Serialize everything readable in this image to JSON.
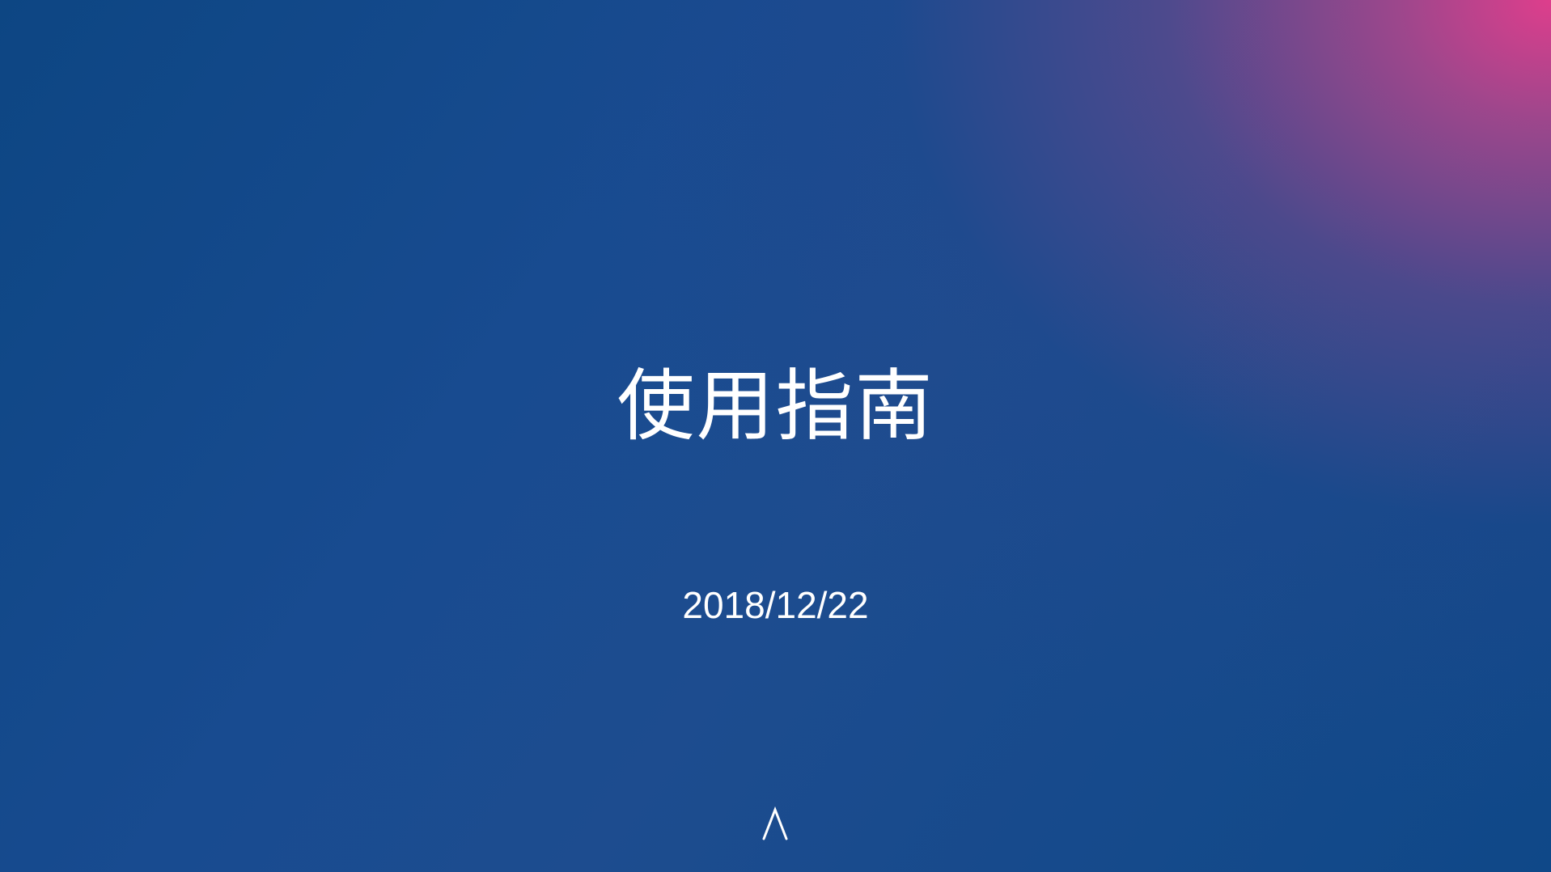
{
  "slide": {
    "title": "使用指南",
    "date": "2018/12/22",
    "nav_icon": "chevron-up-icon"
  },
  "colors": {
    "background_primary": "#0c4687",
    "background_accent": "#de3e8c",
    "text": "#ffffff"
  }
}
